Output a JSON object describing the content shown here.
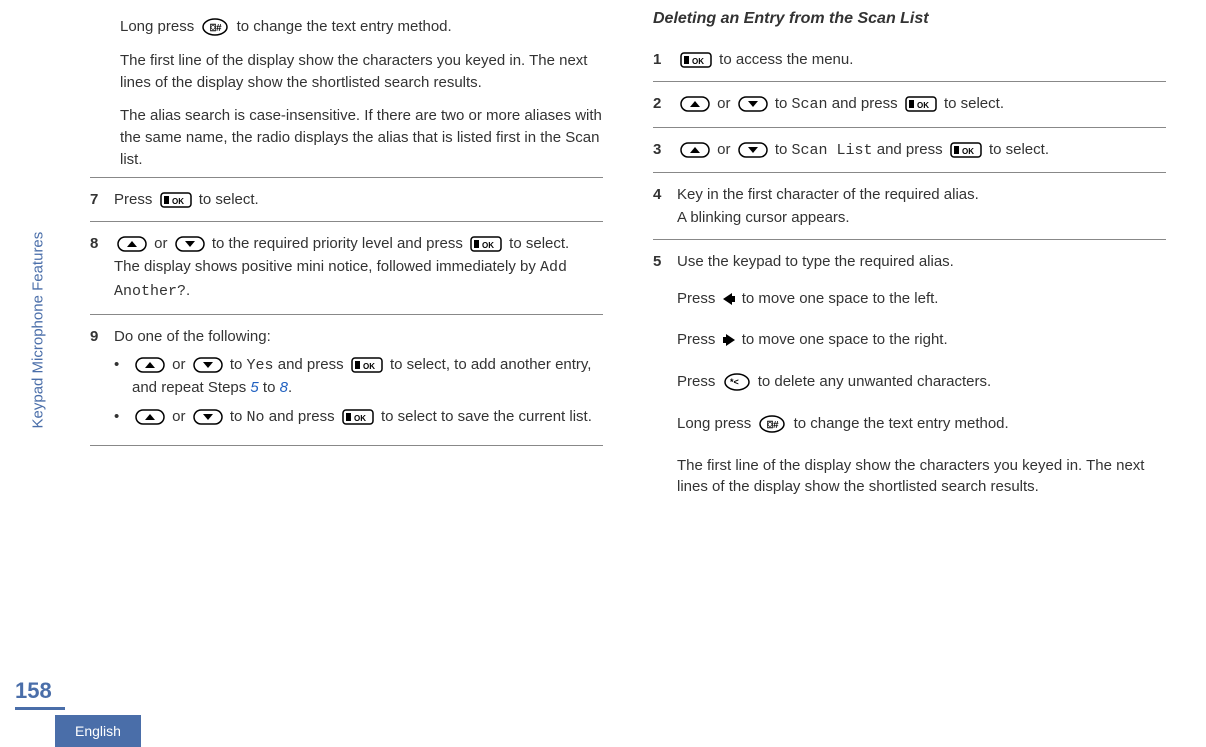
{
  "sidebar": {
    "section_label": "Keypad Microphone Features",
    "page_number": "158",
    "language": "English"
  },
  "left": {
    "intro_para1_a": "Long press ",
    "intro_para1_b": " to change the text entry method.",
    "intro_para2": "The first line of the display show the characters you keyed in. The next lines of the display show the shortlisted search results.",
    "intro_para3": "The alias search is case-insensitive. If there are two or more aliases with the same name, the radio displays the alias that is listed first in the Scan list.",
    "step7": {
      "num": "7",
      "a": "Press ",
      "b": " to select."
    },
    "step8": {
      "num": "8",
      "a": " or ",
      "b": " to the required priority level and press ",
      "c": " to select.",
      "d": "The display shows positive mini notice, followed immediately by ",
      "mono": "Add Another?",
      "e": "."
    },
    "step9": {
      "num": "9",
      "lead": "Do one of the following:",
      "b1_a": " or ",
      "b1_b": " to ",
      "b1_mono": "Yes",
      "b1_c": " and press ",
      "b1_d": " to select, to add another entry, and repeat Steps ",
      "b1_xref1": "5",
      "b1_mid": " to ",
      "b1_xref2": "8",
      "b1_end": ".",
      "b2_a": " or ",
      "b2_b": " to ",
      "b2_mono": "No",
      "b2_c": " and press ",
      "b2_d": " to select to save the current list."
    }
  },
  "right": {
    "heading": "Deleting an Entry from the Scan List",
    "step1": {
      "num": "1",
      "a": " to access the menu."
    },
    "step2": {
      "num": "2",
      "a": " or ",
      "b": " to ",
      "mono": "Scan",
      "c": " and press ",
      "d": " to select."
    },
    "step3": {
      "num": "3",
      "a": " or ",
      "b": " to ",
      "mono": "Scan List",
      "c": " and press ",
      "d": " to select."
    },
    "step4": {
      "num": "4",
      "a": "Key in the first character of the required alias.",
      "b": "A blinking cursor appears."
    },
    "step5": {
      "num": "5",
      "lead": "Use the keypad to type the required alias.",
      "p1_a": "Press ",
      "p1_b": " to move one space to the left.",
      "p2_a": "Press ",
      "p2_b": " to move one space to the right.",
      "p3_a": "Press ",
      "p3_b": " to delete any unwanted characters.",
      "p4_a": "Long press ",
      "p4_b": " to change the text entry method.",
      "p5": "The first line of the display show the characters you keyed in. The next lines of the display show the shortlisted search results."
    }
  }
}
